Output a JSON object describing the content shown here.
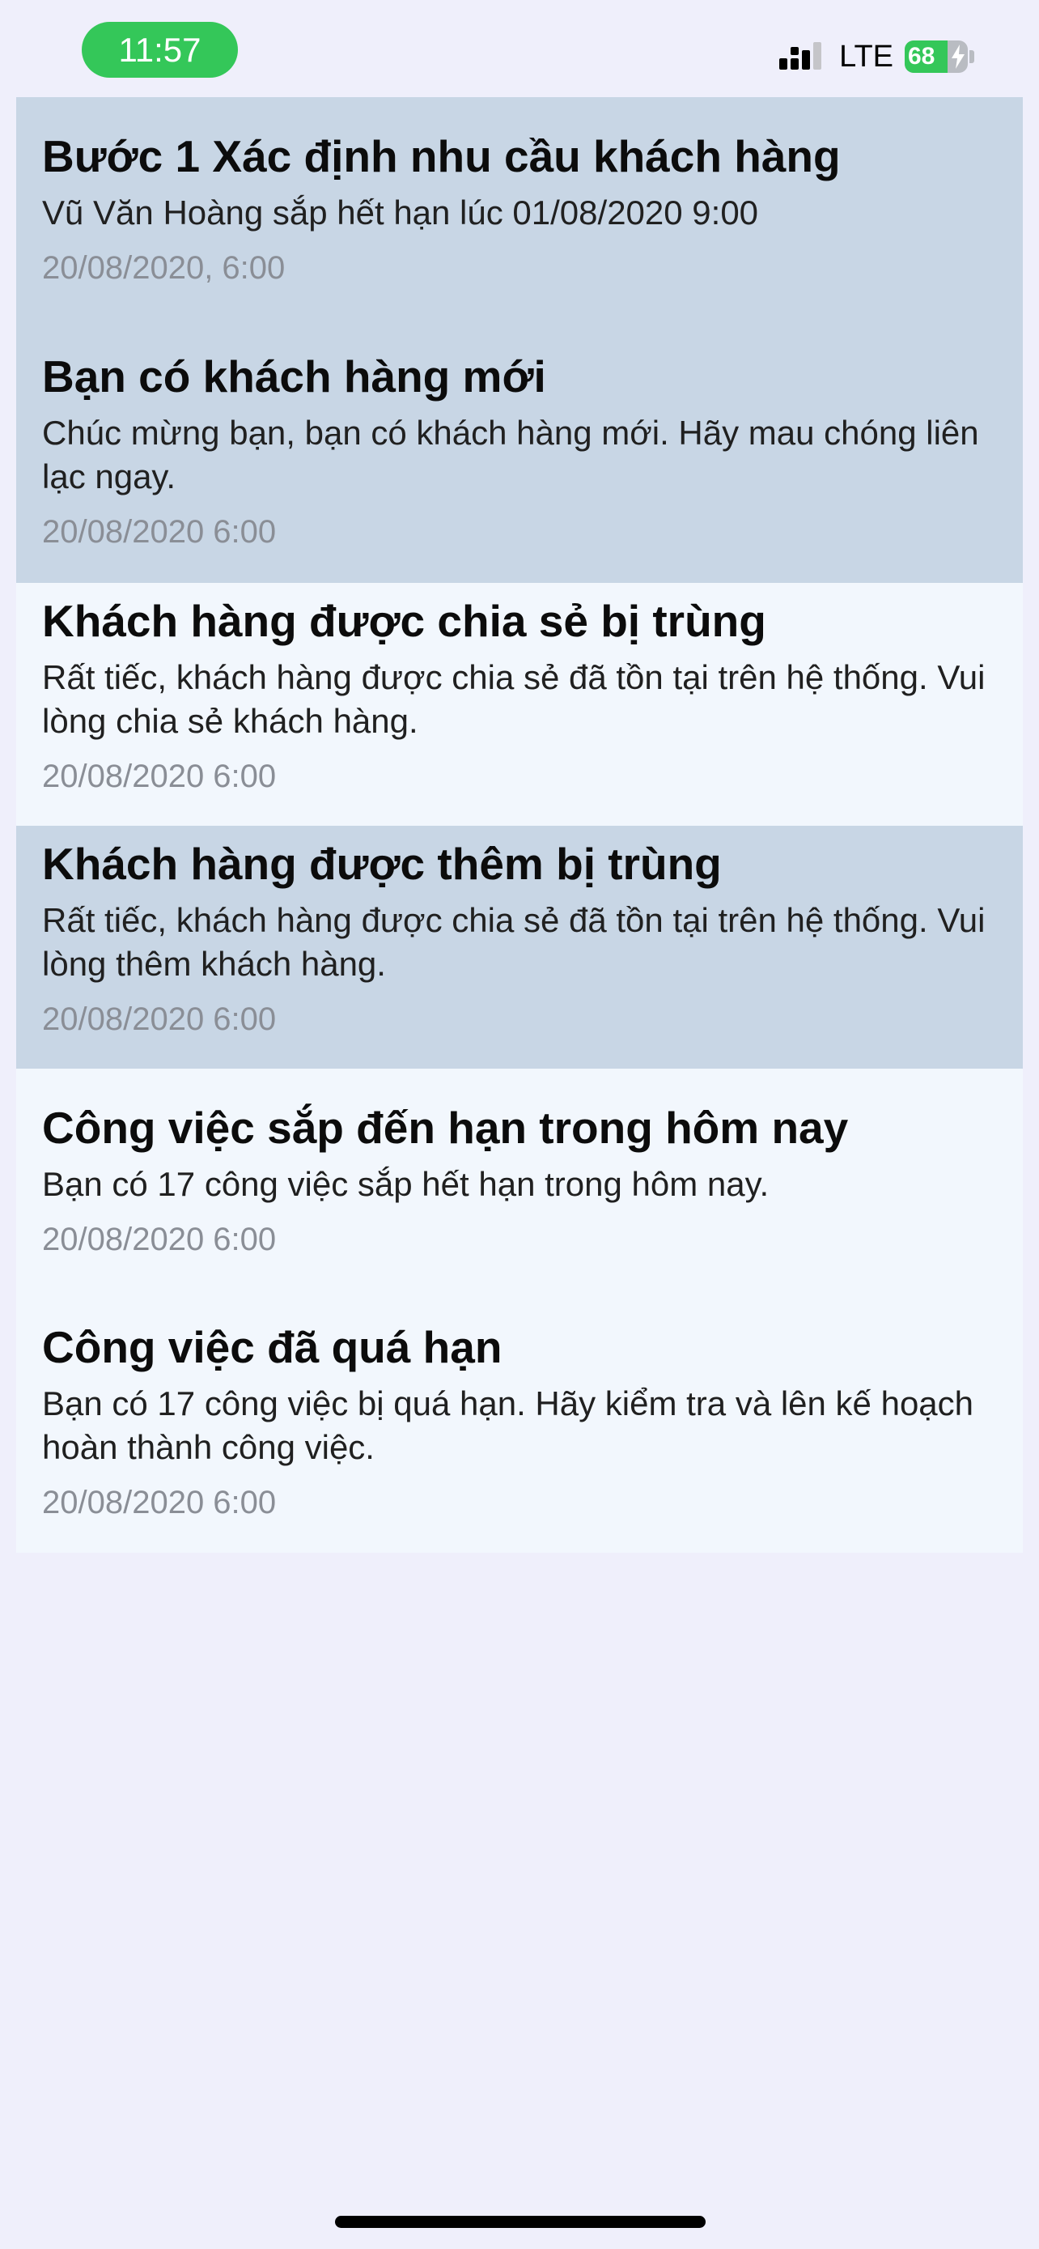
{
  "status_bar": {
    "time": "11:57",
    "network": "LTE",
    "battery_level": "68",
    "battery_fraction": 0.68,
    "signal_icon": "signal-bars-icon",
    "battery_icon": "battery-charging-icon"
  },
  "colors": {
    "unread_background": "#c8d6e5",
    "read_background": "#f2f7fd",
    "page_background": "#efeffb",
    "time_pill": "#34c759"
  },
  "notifications": [
    {
      "title": "Bước 1 Xác định nhu cầu khách hàng",
      "body": "Vũ Văn Hoàng sắp hết hạn lúc 01/08/2020 9:00",
      "time": "20/08/2020, 6:00",
      "status": "unread"
    },
    {
      "title": "Bạn có khách hàng mới",
      "body": "Chúc mừng bạn, bạn có khách hàng mới. Hãy mau chóng liên lạc ngay.",
      "time": "20/08/2020 6:00",
      "status": "unread"
    },
    {
      "title": "Khách hàng được chia sẻ bị trùng",
      "body": "Rất tiếc, khách hàng được chia sẻ đã tồn tại trên hệ thống. Vui lòng chia sẻ khách hàng.",
      "time": "20/08/2020 6:00",
      "status": "read"
    },
    {
      "title": "Khách hàng được thêm bị trùng",
      "body": "Rất tiếc, khách hàng được chia sẻ đã tồn tại trên hệ thống. Vui lòng thêm khách hàng.",
      "time": "20/08/2020 6:00",
      "status": "unread"
    },
    {
      "title": "Công việc sắp đến hạn trong hôm nay",
      "body": "Bạn có 17 công việc sắp hết hạn trong hôm nay.",
      "time": "20/08/2020 6:00",
      "status": "read"
    },
    {
      "title": "Công việc đã quá hạn",
      "body": "Bạn có 17 công việc bị quá hạn. Hãy kiểm tra và lên kế hoạch hoàn thành công việc.",
      "time": "20/08/2020 6:00",
      "status": "read"
    }
  ]
}
